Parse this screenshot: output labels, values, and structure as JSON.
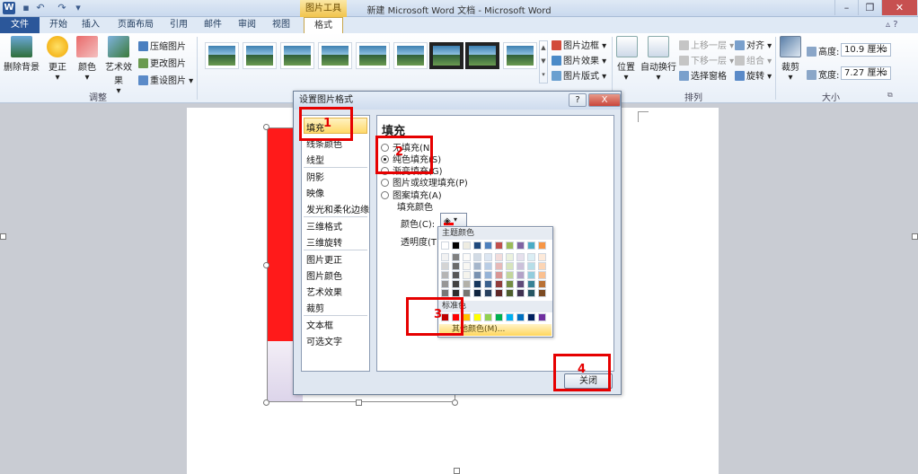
{
  "window": {
    "title": "新建 Microsoft Word 文档 - Microsoft Word",
    "context_tool": "图片工具",
    "app_icon": "W",
    "qat": [
      "save-icon",
      "undo-icon",
      "redo-icon",
      "customize-icon"
    ]
  },
  "tabs": [
    "文件",
    "开始",
    "插入",
    "页面布局",
    "引用",
    "邮件",
    "审阅",
    "视图",
    "格式"
  ],
  "ribbon": {
    "adjust": {
      "label": "调整",
      "buttons": [
        "删除背景",
        "更正",
        "颜色",
        "艺术效果"
      ],
      "small": [
        "压缩图片",
        "更改图片",
        "重设图片"
      ]
    },
    "picture_styles": {
      "right": [
        "图片边框",
        "图片效果",
        "图片版式"
      ]
    },
    "arrange": {
      "label": "排列",
      "buttons": [
        "位置",
        "自动换行"
      ],
      "small": [
        "上移一层",
        "下移一层",
        "选择窗格",
        "对齐",
        "组合",
        "旋转"
      ]
    },
    "size": {
      "label": "大小",
      "crop": "裁剪",
      "height_label": "高度:",
      "height_value": "10.9 厘米",
      "width_label": "宽度:",
      "width_value": "7.27 厘米"
    }
  },
  "dialog": {
    "title": "设置图片格式",
    "help": "?",
    "close_x": "X",
    "nav": [
      "填充",
      "线条颜色",
      "线型",
      "阴影",
      "映像",
      "发光和柔化边缘",
      "三维格式",
      "三维旋转",
      "图片更正",
      "图片颜色",
      "艺术效果",
      "裁剪",
      "文本框",
      "可选文字"
    ],
    "panel_title": "填充",
    "options": [
      "无填充(N)",
      "纯色填充(S)",
      "渐变填充(G)",
      "图片或纹理填充(P)",
      "图案填充(A)"
    ],
    "fill_color_label": "填充颜色",
    "color_label": "颜色(C):",
    "transparency_label": "透明度(T):",
    "close_button": "关闭"
  },
  "palette": {
    "theme_label": "主题颜色",
    "standard_label": "标准色",
    "more_label": "其他颜色(M)...",
    "theme_top": [
      "#ffffff",
      "#000000",
      "#eeece1",
      "#1f497d",
      "#4f81bd",
      "#c0504d",
      "#9bbb59",
      "#8064a2",
      "#4bacc6",
      "#f79646"
    ],
    "standard": [
      "#c00000",
      "#ff0000",
      "#ffc000",
      "#ffff00",
      "#92d050",
      "#00b050",
      "#00b0f0",
      "#0070c0",
      "#002060",
      "#7030a0"
    ]
  },
  "annotations": [
    "1",
    "2",
    "3",
    "4"
  ]
}
